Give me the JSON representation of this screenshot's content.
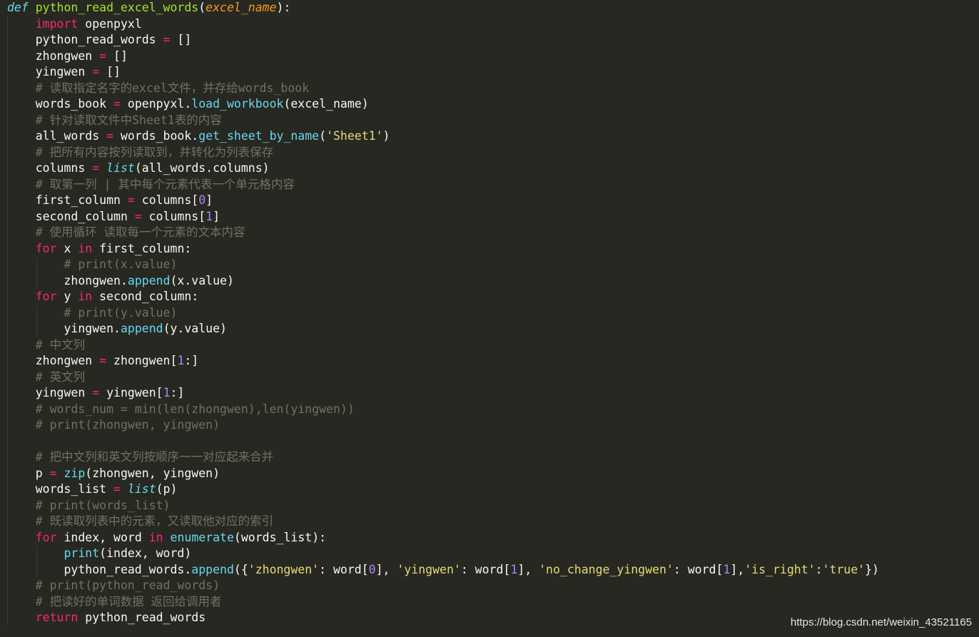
{
  "code_lines": [
    [
      {
        "t": "def",
        "c": "st"
      },
      {
        "t": " ",
        "c": "pl"
      },
      {
        "t": "python_read_excel_words",
        "c": "fn"
      },
      {
        "t": "(",
        "c": "pl"
      },
      {
        "t": "excel_name",
        "c": "ar"
      },
      {
        "t": "):",
        "c": "pl"
      }
    ],
    [
      {
        "t": "    ",
        "c": "pl"
      },
      {
        "t": "import",
        "c": "kw"
      },
      {
        "t": " openpyxl",
        "c": "pl"
      }
    ],
    [
      {
        "t": "    python_read_words ",
        "c": "pl"
      },
      {
        "t": "=",
        "c": "op"
      },
      {
        "t": " []",
        "c": "pl"
      }
    ],
    [
      {
        "t": "    zhongwen ",
        "c": "pl"
      },
      {
        "t": "=",
        "c": "op"
      },
      {
        "t": " []",
        "c": "pl"
      }
    ],
    [
      {
        "t": "    yingwen ",
        "c": "pl"
      },
      {
        "t": "=",
        "c": "op"
      },
      {
        "t": " []",
        "c": "pl"
      }
    ],
    [
      {
        "t": "    ",
        "c": "pl"
      },
      {
        "t": "# 读取指定名字的excel文件，并存给words_book",
        "c": "cm"
      }
    ],
    [
      {
        "t": "    words_book ",
        "c": "pl"
      },
      {
        "t": "=",
        "c": "op"
      },
      {
        "t": " openpyxl.",
        "c": "pl"
      },
      {
        "t": "load_workbook",
        "c": "bi"
      },
      {
        "t": "(excel_name)",
        "c": "pl"
      }
    ],
    [
      {
        "t": "    ",
        "c": "pl"
      },
      {
        "t": "# 针对读取文件中Sheet1表的内容",
        "c": "cm"
      }
    ],
    [
      {
        "t": "    all_words ",
        "c": "pl"
      },
      {
        "t": "=",
        "c": "op"
      },
      {
        "t": " words_book.",
        "c": "pl"
      },
      {
        "t": "get_sheet_by_name",
        "c": "bi"
      },
      {
        "t": "(",
        "c": "pl"
      },
      {
        "t": "'Sheet1'",
        "c": "str"
      },
      {
        "t": ")",
        "c": "pl"
      }
    ],
    [
      {
        "t": "    ",
        "c": "pl"
      },
      {
        "t": "# 把所有内容按列读取到，并转化为列表保存",
        "c": "cm"
      }
    ],
    [
      {
        "t": "    columns ",
        "c": "pl"
      },
      {
        "t": "=",
        "c": "op"
      },
      {
        "t": " ",
        "c": "pl"
      },
      {
        "t": "list",
        "c": "bi-i"
      },
      {
        "t": "(all_words.columns)",
        "c": "pl"
      }
    ],
    [
      {
        "t": "    ",
        "c": "pl"
      },
      {
        "t": "# 取第一列 | 其中每个元素代表一个单元格内容",
        "c": "cm"
      }
    ],
    [
      {
        "t": "    first_column ",
        "c": "pl"
      },
      {
        "t": "=",
        "c": "op"
      },
      {
        "t": " columns[",
        "c": "pl"
      },
      {
        "t": "0",
        "c": "num"
      },
      {
        "t": "]",
        "c": "pl"
      }
    ],
    [
      {
        "t": "    second_column ",
        "c": "pl"
      },
      {
        "t": "=",
        "c": "op"
      },
      {
        "t": " columns[",
        "c": "pl"
      },
      {
        "t": "1",
        "c": "num"
      },
      {
        "t": "]",
        "c": "pl"
      }
    ],
    [
      {
        "t": "    ",
        "c": "pl"
      },
      {
        "t": "# 使用循环 读取每一个元素的文本内容",
        "c": "cm"
      }
    ],
    [
      {
        "t": "    ",
        "c": "pl"
      },
      {
        "t": "for",
        "c": "kw"
      },
      {
        "t": " x ",
        "c": "pl"
      },
      {
        "t": "in",
        "c": "kw"
      },
      {
        "t": " first_column:",
        "c": "pl"
      }
    ],
    [
      {
        "t": "        ",
        "c": "pl"
      },
      {
        "t": "# print(x.value)",
        "c": "cm"
      }
    ],
    [
      {
        "t": "        zhongwen.",
        "c": "pl"
      },
      {
        "t": "append",
        "c": "bi"
      },
      {
        "t": "(x.value)",
        "c": "pl"
      }
    ],
    [
      {
        "t": "    ",
        "c": "pl"
      },
      {
        "t": "for",
        "c": "kw"
      },
      {
        "t": " y ",
        "c": "pl"
      },
      {
        "t": "in",
        "c": "kw"
      },
      {
        "t": " second_column:",
        "c": "pl"
      }
    ],
    [
      {
        "t": "        ",
        "c": "pl"
      },
      {
        "t": "# print(y.value)",
        "c": "cm"
      }
    ],
    [
      {
        "t": "        yingwen.",
        "c": "pl"
      },
      {
        "t": "append",
        "c": "bi"
      },
      {
        "t": "(y.value)",
        "c": "pl"
      }
    ],
    [
      {
        "t": "    ",
        "c": "pl"
      },
      {
        "t": "# 中文列",
        "c": "cm"
      }
    ],
    [
      {
        "t": "    zhongwen ",
        "c": "pl"
      },
      {
        "t": "=",
        "c": "op"
      },
      {
        "t": " zhongwen[",
        "c": "pl"
      },
      {
        "t": "1",
        "c": "num"
      },
      {
        "t": ":]",
        "c": "pl"
      }
    ],
    [
      {
        "t": "    ",
        "c": "pl"
      },
      {
        "t": "# 英文列",
        "c": "cm"
      }
    ],
    [
      {
        "t": "    yingwen ",
        "c": "pl"
      },
      {
        "t": "=",
        "c": "op"
      },
      {
        "t": " yingwen[",
        "c": "pl"
      },
      {
        "t": "1",
        "c": "num"
      },
      {
        "t": ":]",
        "c": "pl"
      }
    ],
    [
      {
        "t": "    ",
        "c": "pl"
      },
      {
        "t": "# words_num = min(len(zhongwen),len(yingwen))",
        "c": "cm"
      }
    ],
    [
      {
        "t": "    ",
        "c": "pl"
      },
      {
        "t": "# print(zhongwen, yingwen)",
        "c": "cm"
      }
    ],
    [
      {
        "t": "",
        "c": "pl"
      }
    ],
    [
      {
        "t": "    ",
        "c": "pl"
      },
      {
        "t": "# 把中文列和英文列按顺序一一对应起来合并",
        "c": "cm"
      }
    ],
    [
      {
        "t": "    p ",
        "c": "pl"
      },
      {
        "t": "=",
        "c": "op"
      },
      {
        "t": " ",
        "c": "pl"
      },
      {
        "t": "zip",
        "c": "bi"
      },
      {
        "t": "(zhongwen, yingwen)",
        "c": "pl"
      }
    ],
    [
      {
        "t": "    words_list ",
        "c": "pl"
      },
      {
        "t": "=",
        "c": "op"
      },
      {
        "t": " ",
        "c": "pl"
      },
      {
        "t": "list",
        "c": "bi-i"
      },
      {
        "t": "(p)",
        "c": "pl"
      }
    ],
    [
      {
        "t": "    ",
        "c": "pl"
      },
      {
        "t": "# print(words_list)",
        "c": "cm"
      }
    ],
    [
      {
        "t": "    ",
        "c": "pl"
      },
      {
        "t": "# 既读取列表中的元素，又读取他对应的索引",
        "c": "cm"
      }
    ],
    [
      {
        "t": "    ",
        "c": "pl"
      },
      {
        "t": "for",
        "c": "kw"
      },
      {
        "t": " index, word ",
        "c": "pl"
      },
      {
        "t": "in",
        "c": "kw"
      },
      {
        "t": " ",
        "c": "pl"
      },
      {
        "t": "enumerate",
        "c": "bi"
      },
      {
        "t": "(words_list):",
        "c": "pl"
      }
    ],
    [
      {
        "t": "        ",
        "c": "pl"
      },
      {
        "t": "print",
        "c": "bi"
      },
      {
        "t": "(index, word)",
        "c": "pl"
      }
    ],
    [
      {
        "t": "        python_read_words.",
        "c": "pl"
      },
      {
        "t": "append",
        "c": "bi"
      },
      {
        "t": "({",
        "c": "pl"
      },
      {
        "t": "'zhongwen'",
        "c": "str"
      },
      {
        "t": ": word[",
        "c": "pl"
      },
      {
        "t": "0",
        "c": "num"
      },
      {
        "t": "], ",
        "c": "pl"
      },
      {
        "t": "'yingwen'",
        "c": "str"
      },
      {
        "t": ": word[",
        "c": "pl"
      },
      {
        "t": "1",
        "c": "num"
      },
      {
        "t": "], ",
        "c": "pl"
      },
      {
        "t": "'no_change_yingwen'",
        "c": "str"
      },
      {
        "t": ": word[",
        "c": "pl"
      },
      {
        "t": "1",
        "c": "num"
      },
      {
        "t": "],",
        "c": "pl"
      },
      {
        "t": "'is_right'",
        "c": "str"
      },
      {
        "t": ":",
        "c": "pl"
      },
      {
        "t": "'true'",
        "c": "str"
      },
      {
        "t": "})",
        "c": "pl"
      }
    ],
    [
      {
        "t": "    ",
        "c": "pl"
      },
      {
        "t": "# print(python_read_words)",
        "c": "cm"
      }
    ],
    [
      {
        "t": "    ",
        "c": "pl"
      },
      {
        "t": "# 把读好的单词数据 返回给调用者",
        "c": "cm"
      }
    ],
    [
      {
        "t": "    ",
        "c": "pl"
      },
      {
        "t": "return",
        "c": "kw"
      },
      {
        "t": " python_read_words",
        "c": "pl"
      }
    ]
  ],
  "watermark": "https://blog.csdn.net/weixin_43521165",
  "colors": {
    "background": "#272822",
    "keyword": "#F92672",
    "function_name": "#A6E22E",
    "builtin": "#66D9EF",
    "parameter": "#FD971F",
    "string": "#E6DB74",
    "number": "#AE81FF",
    "comment": "#75715E",
    "plain": "#F8F8F2"
  }
}
